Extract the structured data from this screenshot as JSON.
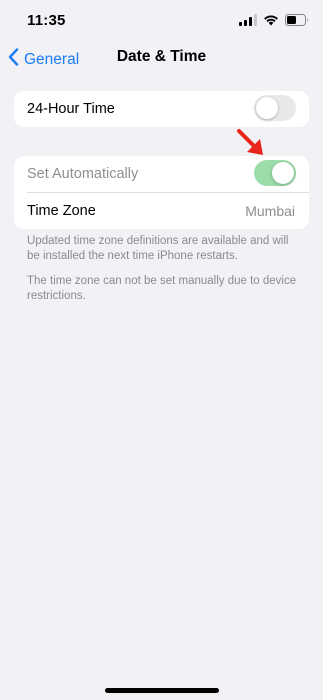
{
  "status_bar": {
    "time": "11:35",
    "icons": [
      "signal-icon",
      "wifi-icon",
      "battery-icon"
    ]
  },
  "nav": {
    "back_label": "General",
    "title": "Date & Time",
    "accent_color": "#1a7cf7"
  },
  "group1": {
    "hour24_label": "24-Hour Time",
    "hour24_on": false
  },
  "group2": {
    "auto_label": "Set Automatically",
    "auto_on": true,
    "auto_color": "#9bdcaa",
    "timezone_label": "Time Zone",
    "timezone_value": "Mumbai"
  },
  "footer": {
    "note1": "Updated time zone definitions are available and will be installed the next time iPhone restarts.",
    "note2": "The time zone can not be set manually due to device restrictions."
  },
  "annotation": {
    "arrow_icon": "red-arrow-icon",
    "arrow_color": "#e8261c"
  }
}
